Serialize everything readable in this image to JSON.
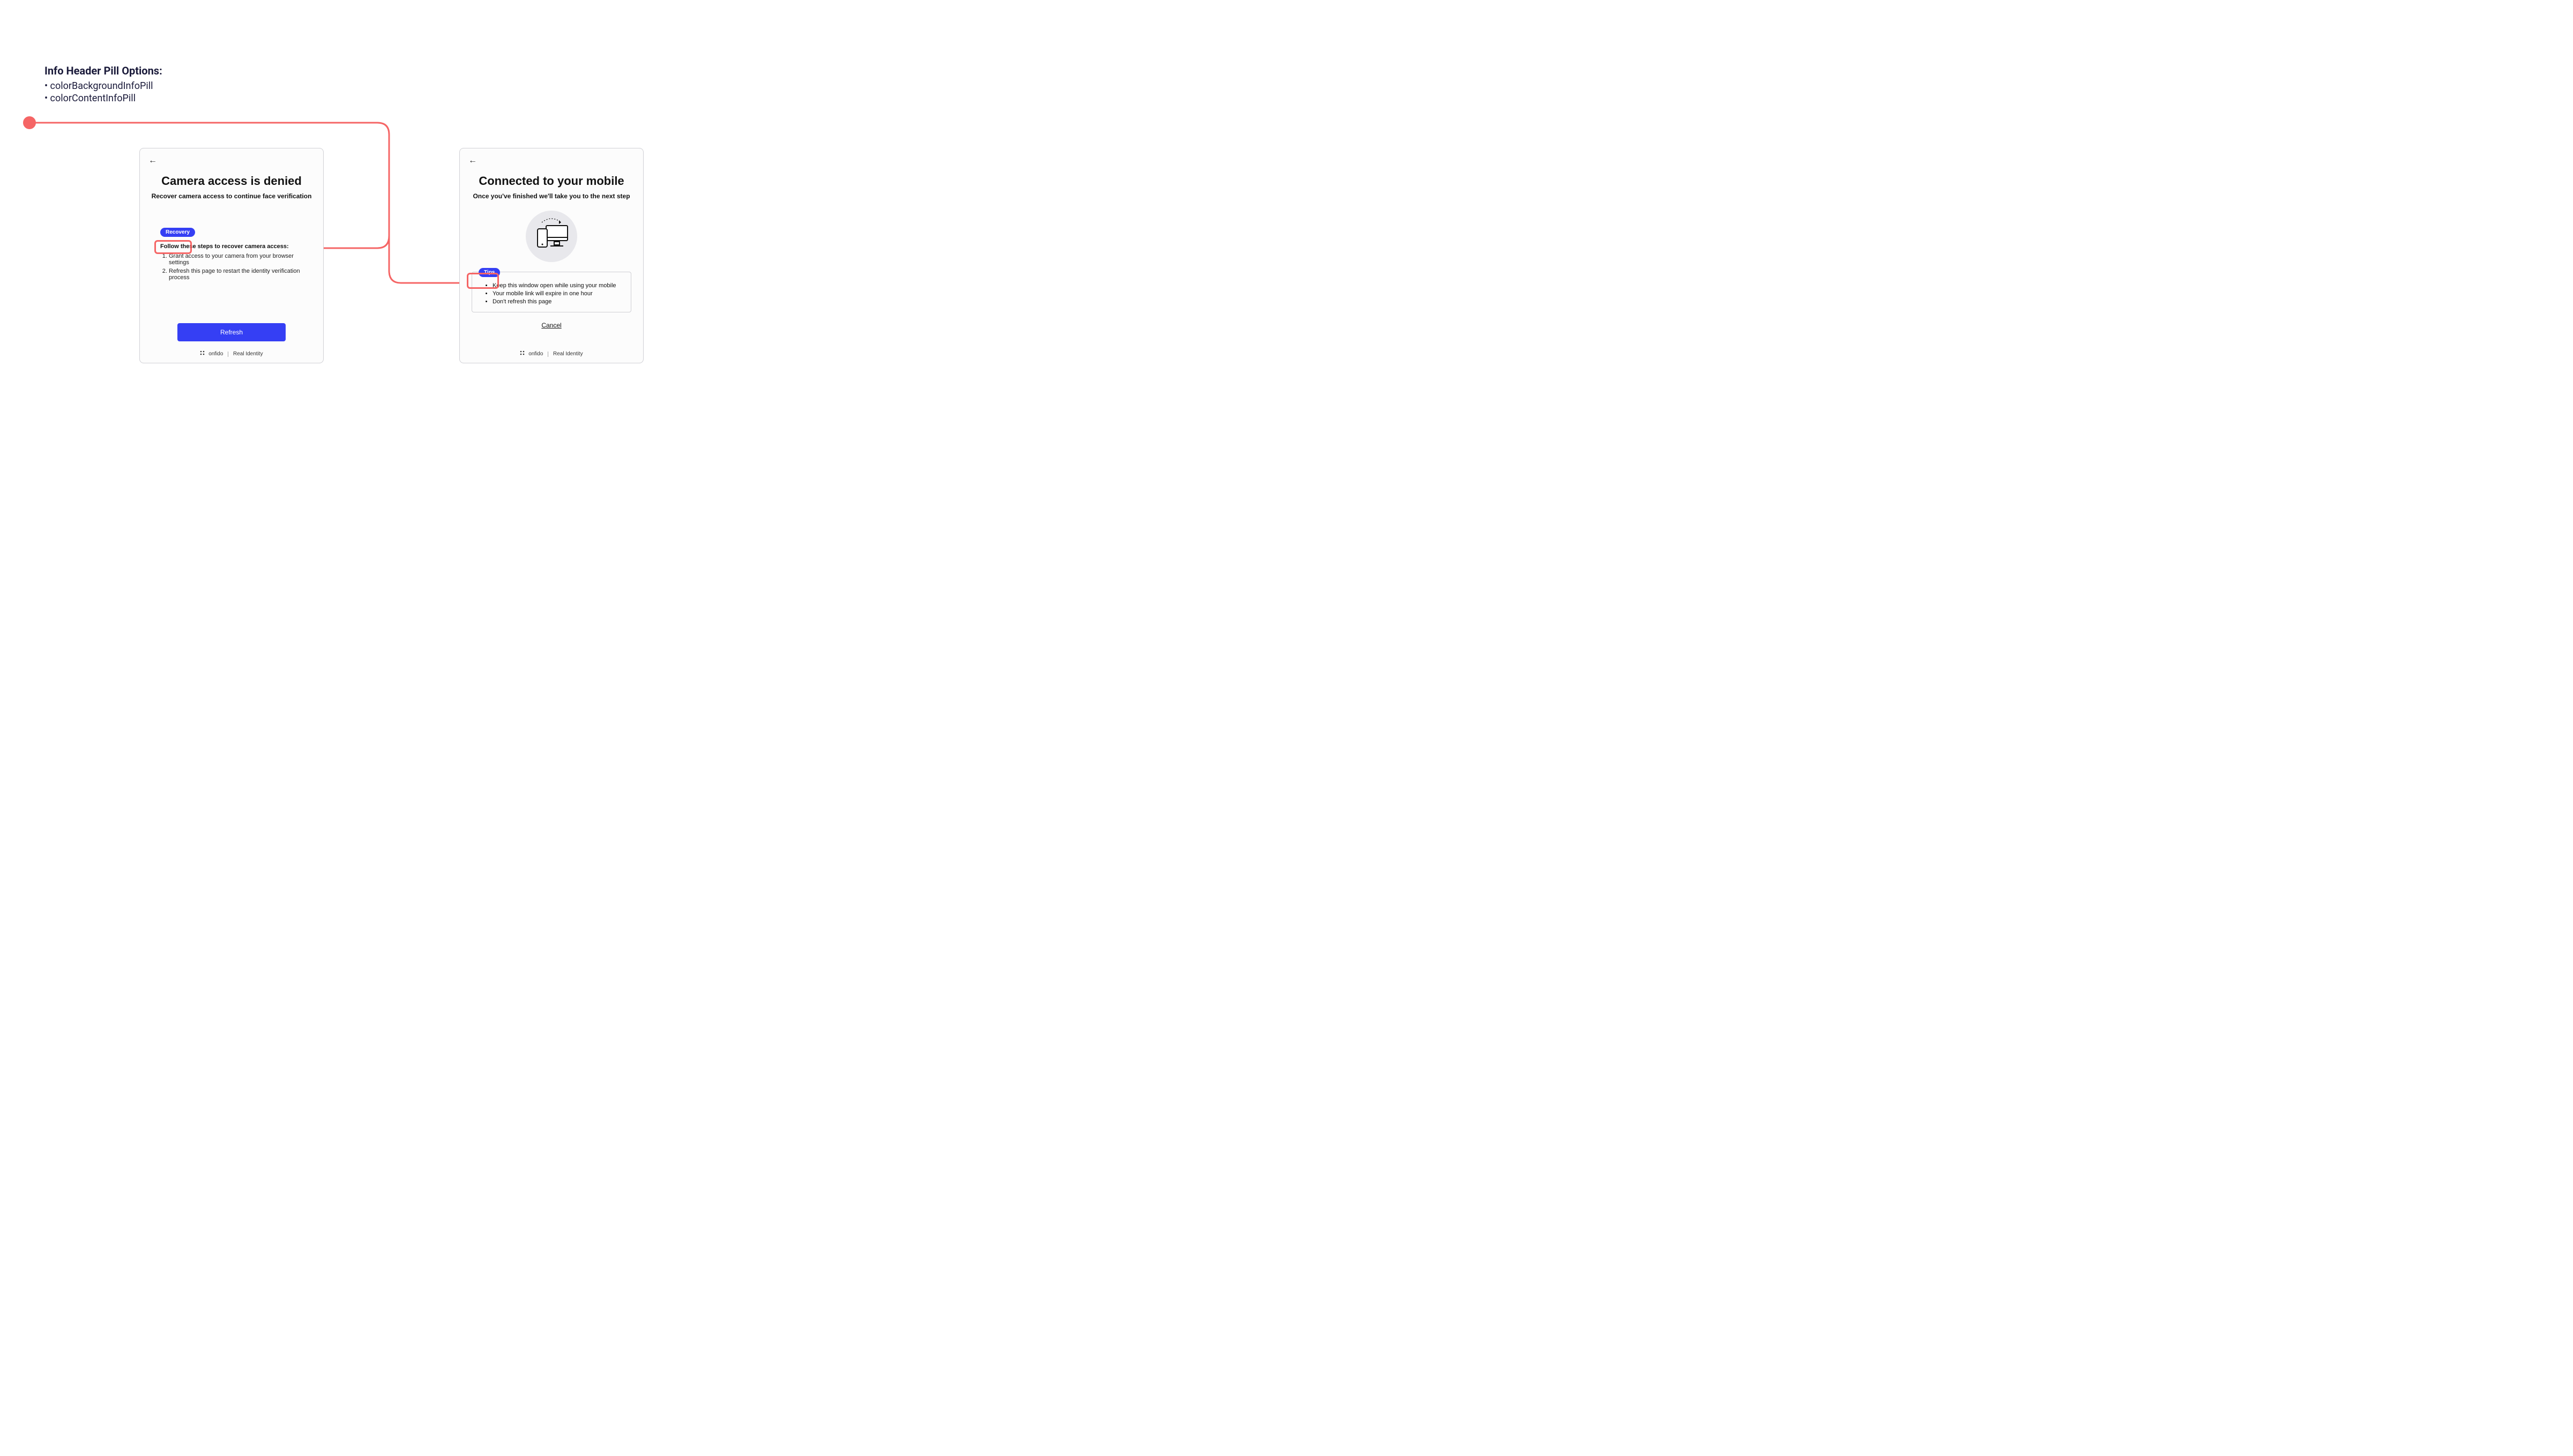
{
  "options": {
    "title": "Info Header Pill Options:",
    "items": [
      "colorBackgroundInfoPill",
      "colorContentInfoPill"
    ]
  },
  "left_card": {
    "title": "Camera access is denied",
    "subtitle": "Recover camera access to continue face verification",
    "pill_label": "Recovery",
    "steps_title": "Follow these steps to recover camera access:",
    "steps": [
      "Grant access to your camera from your browser settings",
      "Refresh this page to restart the identity verification process"
    ],
    "primary_button": "Refresh"
  },
  "right_card": {
    "title": "Connected to your mobile",
    "subtitle": "Once you've finished we'll take you to the next step",
    "pill_label": "Tips",
    "tips": [
      "Keep this window open while using your mobile",
      "Your mobile link will expire in one hour",
      "Don't refresh this page"
    ],
    "cancel_label": "Cancel"
  },
  "footer": {
    "brand": "onfido",
    "tagline": "Real Identity"
  },
  "colors": {
    "coral": "#f56565",
    "blue_pill": "#353ff4",
    "navy": "#1a1a3a"
  }
}
